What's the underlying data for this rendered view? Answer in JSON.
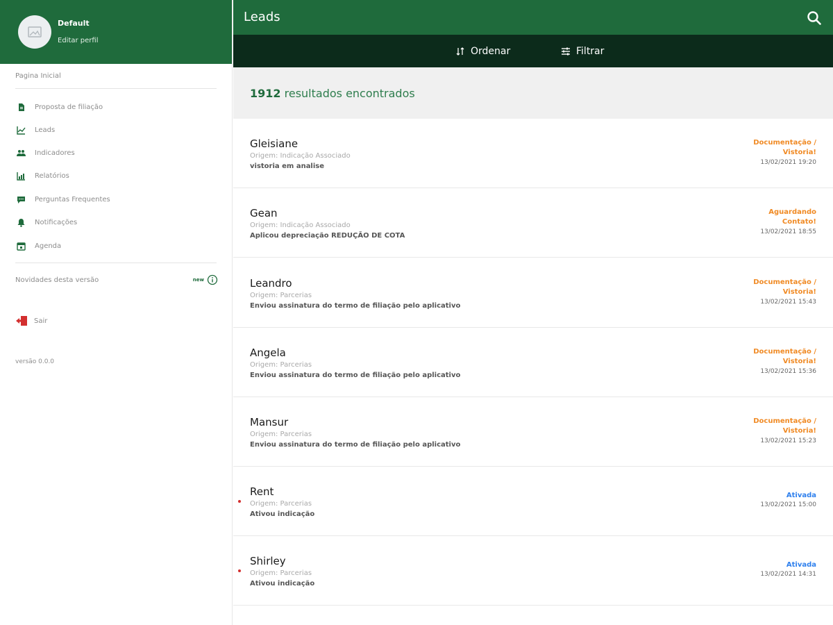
{
  "colors": {
    "brand_green": "#1f6b3c",
    "dark_green": "#0c2b1b",
    "status_orange": "#f08a24",
    "status_blue": "#2f80ed",
    "unread_dot": "#d32f2f"
  },
  "sidebar": {
    "profile": {
      "name": "Default",
      "edit_label": "Editar perfil",
      "avatar_icon": "image-placeholder-icon"
    },
    "home_label": "Pagina Inicial",
    "items": [
      {
        "label": "Proposta de filiação",
        "icon": "document-icon"
      },
      {
        "label": "Leads",
        "icon": "chart-lines-icon"
      },
      {
        "label": "Indicadores",
        "icon": "people-icon"
      },
      {
        "label": "Relatórios",
        "icon": "bar-chart-icon"
      },
      {
        "label": "Perguntas Frequentes",
        "icon": "chat-icon"
      },
      {
        "label": "Notificações",
        "icon": "bell-icon"
      },
      {
        "label": "Agenda",
        "icon": "calendar-icon"
      }
    ],
    "news": {
      "label": "Novidades desta versão",
      "badge": "new",
      "icon": "info-icon"
    },
    "logout_label": "Sair",
    "version_label": "versão 0.0.0"
  },
  "header": {
    "title": "Leads",
    "search_icon": "search-icon",
    "order_label": "Ordenar",
    "filter_label": "Filtrar"
  },
  "results": {
    "count": "1912",
    "text": "resultados encontrados"
  },
  "leads": [
    {
      "name": "Gleisiane",
      "origin": "Origem: Indicação Associado",
      "note": "vistoria em analise",
      "status_line1": "Documentação /",
      "status_line2": "Vistoria!",
      "status_color": "#f08a24",
      "date": "13/02/2021 19:20",
      "unread": false
    },
    {
      "name": "Gean",
      "origin": "Origem: Indicação Associado",
      "note": "Aplicou depreciação REDUÇÃO DE COTA",
      "status_line1": "Aguardando",
      "status_line2": "Contato!",
      "status_color": "#f08a24",
      "date": "13/02/2021 18:55",
      "unread": false
    },
    {
      "name": "Leandro",
      "origin": "Origem: Parcerias",
      "note": "Enviou assinatura do termo de filiação pelo aplicativo",
      "status_line1": "Documentação /",
      "status_line2": "Vistoria!",
      "status_color": "#f08a24",
      "date": "13/02/2021 15:43",
      "unread": false
    },
    {
      "name": "Angela",
      "origin": "Origem: Parcerias",
      "note": "Enviou assinatura do termo de filiação pelo aplicativo",
      "status_line1": "Documentação /",
      "status_line2": "Vistoria!",
      "status_color": "#f08a24",
      "date": "13/02/2021 15:36",
      "unread": false
    },
    {
      "name": "Mansur",
      "origin": "Origem: Parcerias",
      "note": "Enviou assinatura do termo de filiação pelo aplicativo",
      "status_line1": "Documentação /",
      "status_line2": "Vistoria!",
      "status_color": "#f08a24",
      "date": "13/02/2021 15:23",
      "unread": false
    },
    {
      "name": "Rent",
      "origin": "Origem: Parcerias",
      "note": "Ativou indicação",
      "status_line1": "Ativada",
      "status_line2": "",
      "status_color": "#2f80ed",
      "date": "13/02/2021 15:00",
      "unread": true
    },
    {
      "name": "Shirley",
      "origin": "Origem: Parcerias",
      "note": "Ativou indicação",
      "status_line1": "Ativada",
      "status_line2": "",
      "status_color": "#2f80ed",
      "date": "13/02/2021 14:31",
      "unread": true
    }
  ]
}
